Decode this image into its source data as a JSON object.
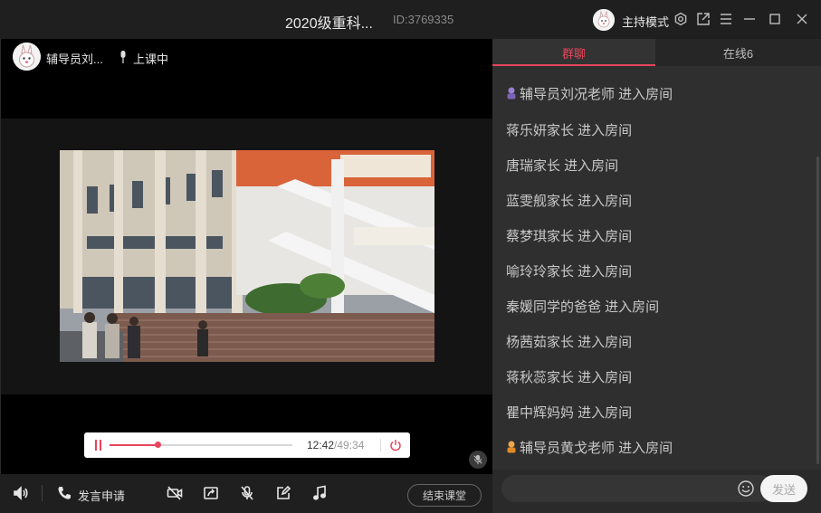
{
  "titlebar": {
    "title": "2020级重科...",
    "room_id": "ID:3769335",
    "mode_label": "主持模式",
    "icons": [
      "avatar",
      "settings-icon",
      "share-icon",
      "menu-icon",
      "minimize-icon",
      "maximize-icon",
      "close-icon"
    ]
  },
  "stage": {
    "teacher_name": "辅导员刘...",
    "status": "上课中",
    "player": {
      "current_time": "12:42",
      "total_time": "/49:34",
      "progress": 0.26
    }
  },
  "toolbar": {
    "apply_speak_label": "发言申请",
    "end_class_label": "结束课堂",
    "icons": [
      "volume-icon",
      "phone-icon",
      "camera-off-icon",
      "screen-share-icon",
      "mic-off-icon",
      "edit-icon",
      "music-icon"
    ]
  },
  "chat": {
    "tabs": [
      {
        "label": "群聊",
        "active": true
      },
      {
        "label": "在线6",
        "active": false
      }
    ],
    "messages": [
      {
        "text": "辅导员刘况老师 进入房间",
        "badge": "purple"
      },
      {
        "text": "蒋乐妍家长 进入房间"
      },
      {
        "text": "唐瑞家长 进入房间"
      },
      {
        "text": "蓝雯舰家长 进入房间"
      },
      {
        "text": "蔡梦琪家长 进入房间"
      },
      {
        "text": "喻玲玲家长 进入房间"
      },
      {
        "text": "秦媛同学的爸爸 进入房间"
      },
      {
        "text": "杨茜茹家长 进入房间"
      },
      {
        "text": "蒋秋蕊家长 进入房间"
      },
      {
        "text": "瞿中辉妈妈 进入房间"
      },
      {
        "text": "辅导员黄戈老师 进入房间",
        "badge": "orange"
      }
    ],
    "input_placeholder": "",
    "send_label": "发送"
  },
  "colors": {
    "accent": "#e8455b",
    "panel": "#2f2f2f",
    "titlebar": "#1f1f1f"
  }
}
